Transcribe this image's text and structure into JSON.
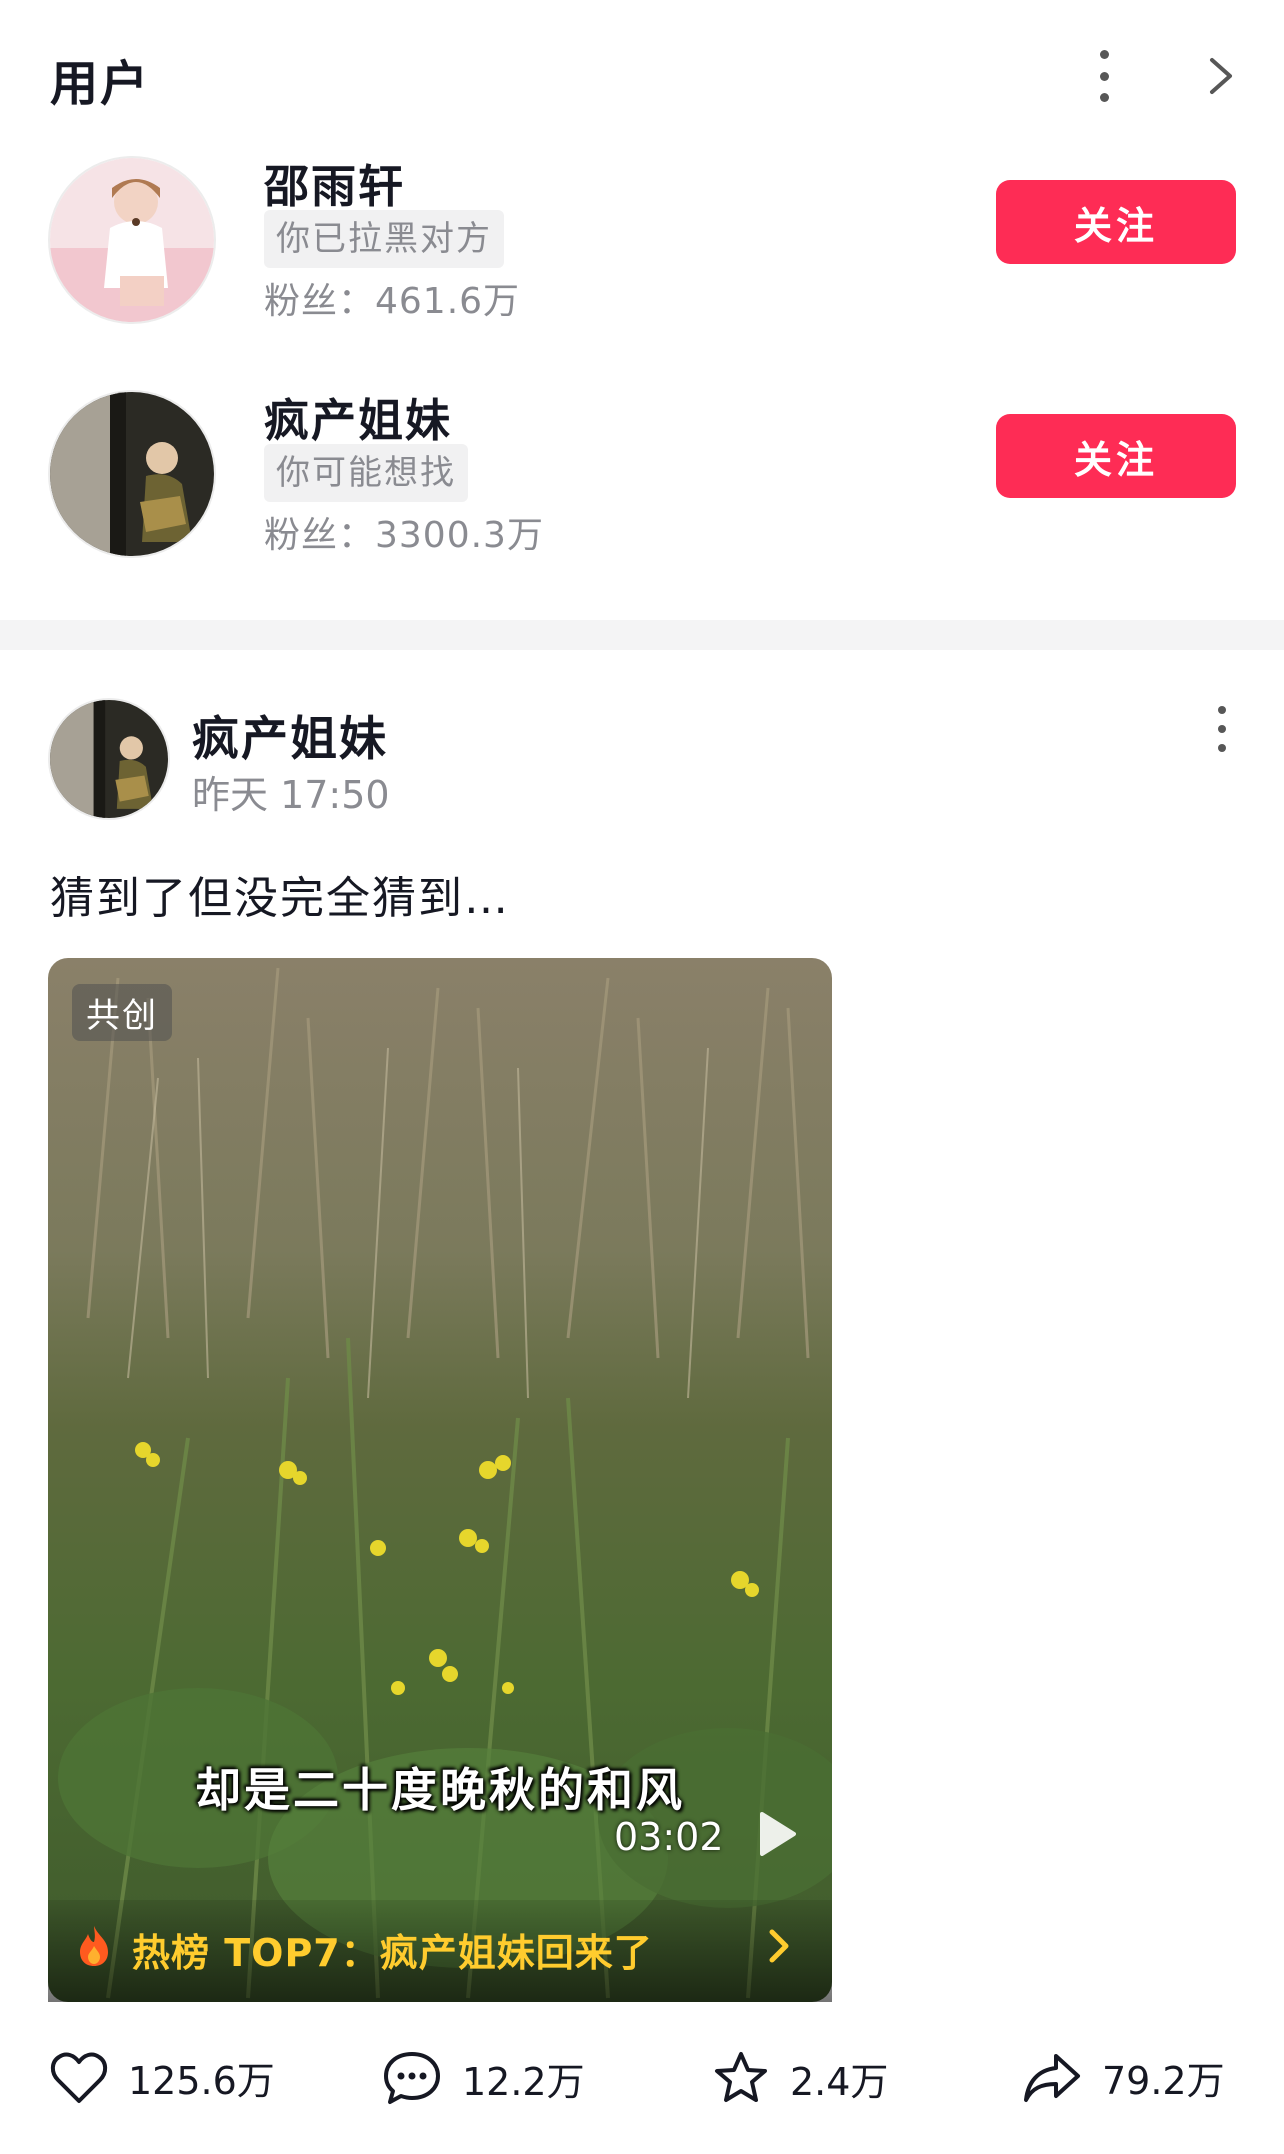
{
  "users_section": {
    "title": "用户",
    "users": [
      {
        "name": "邵雨轩",
        "tag": "你已拉黑对方",
        "fans": "粉丝：461.6万",
        "button": "关注"
      },
      {
        "name": "疯产姐妹",
        "tag": "你可能想找",
        "fans": "粉丝：3300.3万",
        "button": "关注"
      }
    ]
  },
  "post": {
    "author": "疯产姐妹",
    "time": "昨天 17:50",
    "text": "猜到了但没完全猜到…",
    "video": {
      "badge": "共创",
      "subtitle": "却是二十度晚秋的和风",
      "duration": "03:02",
      "hot_label": "热榜 TOP7：疯产姐妹回来了"
    },
    "actions": {
      "likes": "125.6万",
      "comments": "12.2万",
      "favorites": "2.4万",
      "shares": "79.2万"
    }
  },
  "colors": {
    "accent": "#fe2c55",
    "hot": "#ffcc2e",
    "muted": "#8a8b91"
  }
}
